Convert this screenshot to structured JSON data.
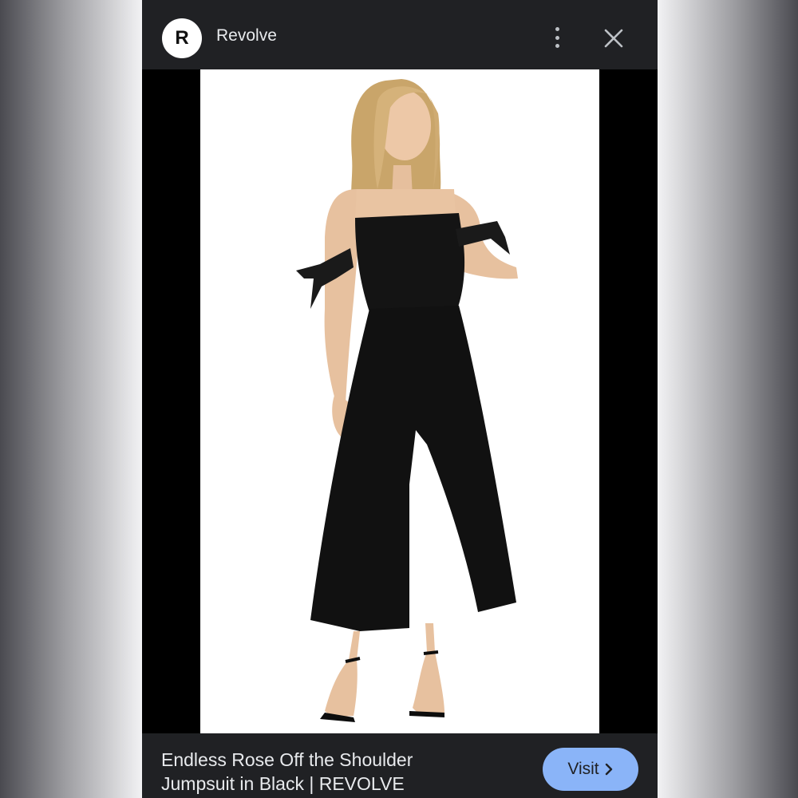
{
  "header": {
    "logo_letter": "R",
    "site_name": "Revolve"
  },
  "image": {
    "alt": "Endless Rose Off the Shoulder Jumpsuit in Black"
  },
  "footer": {
    "title_line1": "Endless Rose Off the Shoulder",
    "title_line2": "Jumpsuit in Black | REVOLVE",
    "visit_label": "Visit"
  },
  "icons": {
    "more": "more-vert-icon",
    "close": "close-icon",
    "visit_arrow": "chevron-right-icon"
  },
  "colors": {
    "bar_background": "#202124",
    "button_accent": "#8ab4f8",
    "text": "#e8eaed"
  }
}
